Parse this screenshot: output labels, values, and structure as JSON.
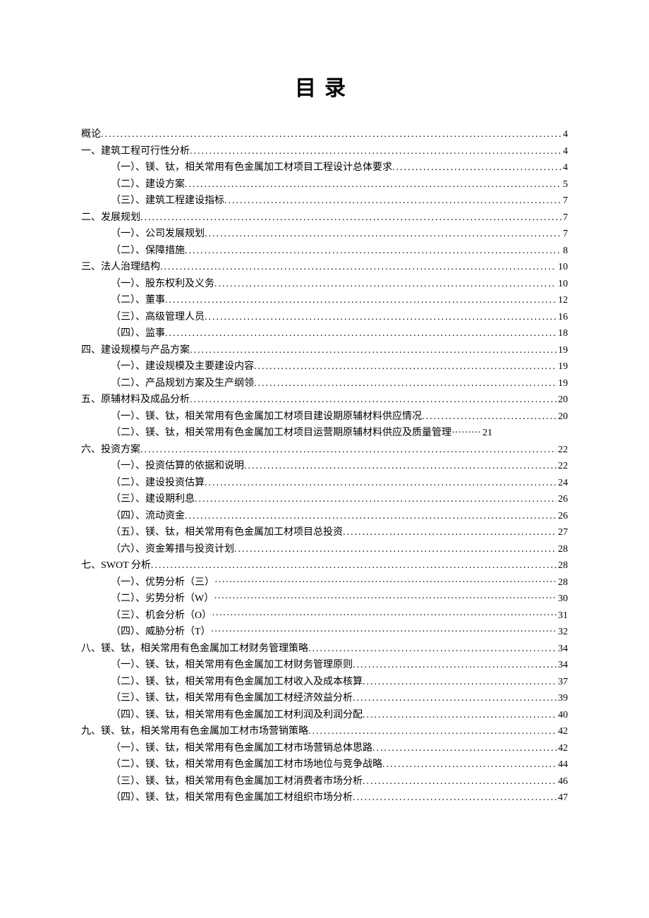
{
  "title": "目录",
  "toc": [
    {
      "label": "概论",
      "page": "4",
      "level": 0,
      "leader": "dot"
    },
    {
      "label": "一、建筑工程可行性分析",
      "page": "4",
      "level": 0,
      "leader": "dot"
    },
    {
      "label": "（一）、镁、钛，相关常用有色金属加工材项目工程设计总体要求",
      "page": "4",
      "level": 1,
      "leader": "dot"
    },
    {
      "label": "（二）、建设方案",
      "page": "5",
      "level": 1,
      "leader": "dot"
    },
    {
      "label": "（三）、建筑工程建设指标",
      "page": "7",
      "level": 1,
      "leader": "dot"
    },
    {
      "label": "二、发展规划",
      "page": "7",
      "level": 0,
      "leader": "dot"
    },
    {
      "label": "（一）、公司发展规划",
      "page": "7",
      "level": 1,
      "leader": "dot"
    },
    {
      "label": "（二）、保障措施",
      "page": "8",
      "level": 1,
      "leader": "dot"
    },
    {
      "label": "三、法人治理结构",
      "page": "10",
      "level": 0,
      "leader": "dot"
    },
    {
      "label": "（一）、股东权利及义务",
      "page": "10",
      "level": 1,
      "leader": "dot"
    },
    {
      "label": "（二）、董事",
      "page": "12",
      "level": 1,
      "leader": "dot"
    },
    {
      "label": "（三）、高级管理人员",
      "page": "16",
      "level": 1,
      "leader": "dot"
    },
    {
      "label": "（四）、监事",
      "page": "18",
      "level": 1,
      "leader": "dot"
    },
    {
      "label": "四、建设规模与产品方案",
      "page": "19",
      "level": 0,
      "leader": "dot"
    },
    {
      "label": "（一）、建设规模及主要建设内容",
      "page": "19",
      "level": 1,
      "leader": "dot"
    },
    {
      "label": "（二）、产品规划方案及生产纲领",
      "page": "19",
      "level": 1,
      "leader": "dot"
    },
    {
      "label": "五、原辅材料及成品分析",
      "page": "20",
      "level": 0,
      "leader": "dot"
    },
    {
      "label": "（一）、镁、钛，相关常用有色金属加工材项目建设期原辅材料供应情况",
      "page": "20",
      "level": 1,
      "leader": "dot"
    },
    {
      "label": "（二）、镁、钛，相关常用有色金属加工材项目运营期原辅材料供应及质量管理",
      "page": "21",
      "level": 1,
      "leader": "mid"
    },
    {
      "label": "六、投资方案",
      "page": "22",
      "level": 0,
      "leader": "dot"
    },
    {
      "label": "（一）、投资估算的依据和说明",
      "page": "22",
      "level": 1,
      "leader": "dot"
    },
    {
      "label": "（二）、建设投资估算",
      "page": "24",
      "level": 1,
      "leader": "dot"
    },
    {
      "label": "（三）、建设期利息",
      "page": "26",
      "level": 1,
      "leader": "dot"
    },
    {
      "label": "（四）、流动资金",
      "page": "26",
      "level": 1,
      "leader": "dot"
    },
    {
      "label": "（五）、镁、钛，相关常用有色金属加工材项目总投资",
      "page": "27",
      "level": 1,
      "leader": "dot"
    },
    {
      "label": "（六）、资金筹措与投资计划",
      "page": "28",
      "level": 1,
      "leader": "dot"
    },
    {
      "label": "七、SWOT 分析",
      "page": "28",
      "level": 0,
      "leader": "dot"
    },
    {
      "label": "（一）、优势分析（三）",
      "page": "28",
      "level": 1,
      "leader": "alt"
    },
    {
      "label": "（二）、劣势分析（W）",
      "page": "30",
      "level": 1,
      "leader": "alt"
    },
    {
      "label": "（三）、机会分析（O）",
      "page": "31",
      "level": 1,
      "leader": "alt"
    },
    {
      "label": "（四）、威胁分析（T）",
      "page": "32",
      "level": 1,
      "leader": "alt"
    },
    {
      "label": "八、镁、钛，相关常用有色金属加工材财务管理策略",
      "page": "34",
      "level": 0,
      "leader": "dot"
    },
    {
      "label": "（一）、镁、钛，相关常用有色金属加工材财务管理原则",
      "page": "34",
      "level": 1,
      "leader": "dot"
    },
    {
      "label": "（二）、镁、钛，相关常用有色金属加工材收入及成本核算",
      "page": "37",
      "level": 1,
      "leader": "dot"
    },
    {
      "label": "（三）、镁、钛，相关常用有色金属加工材经济效益分析",
      "page": "39",
      "level": 1,
      "leader": "dot"
    },
    {
      "label": "（四）、镁、钛，相关常用有色金属加工材利润及利润分配",
      "page": "40",
      "level": 1,
      "leader": "dot"
    },
    {
      "label": "九、镁、钛，相关常用有色金属加工材市场营销策略",
      "page": "42",
      "level": 0,
      "leader": "dot"
    },
    {
      "label": "（一）、镁、钛，相关常用有色金属加工材市场营销总体思路",
      "page": "42",
      "level": 1,
      "leader": "dot"
    },
    {
      "label": "（二）、镁、钛，相关常用有色金属加工材市场地位与竞争战略",
      "page": "44",
      "level": 1,
      "leader": "dot"
    },
    {
      "label": "（三）、镁、钛，相关常用有色金属加工材消费者市场分析",
      "page": "46",
      "level": 1,
      "leader": "dot"
    },
    {
      "label": "（四）、镁、钛，相关常用有色金属加工材组织市场分析",
      "page": "47",
      "level": 1,
      "leader": "dot"
    }
  ]
}
